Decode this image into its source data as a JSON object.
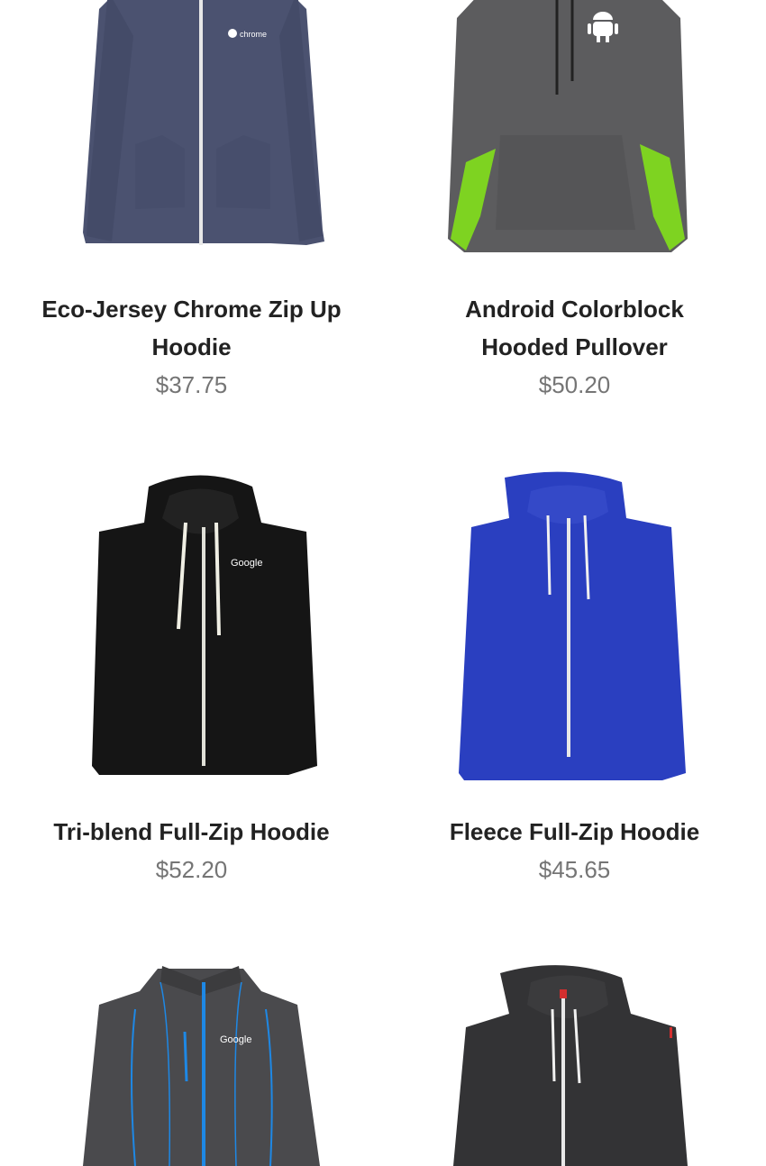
{
  "products": [
    {
      "title": "Eco-Jersey Chrome Zip Up Hoodie",
      "price": "$37.75",
      "logo": "chrome",
      "color": "#4b5270"
    },
    {
      "title": "Android Colorblock Hooded Pullover",
      "price": "$50.20",
      "logo": "android",
      "color": "#5c5c5e"
    },
    {
      "title": "Tri-blend Full-Zip Hoodie",
      "price": "$52.20",
      "logo": "Google",
      "color": "#151515"
    },
    {
      "title": "Fleece Full-Zip Hoodie",
      "price": "$45.65",
      "logo": "",
      "color": "#2a3fc0"
    },
    {
      "title": "",
      "price": "",
      "logo": "Google",
      "color": "#4a4a4d"
    },
    {
      "title": "",
      "price": "",
      "logo": "",
      "color": "#333335"
    }
  ]
}
